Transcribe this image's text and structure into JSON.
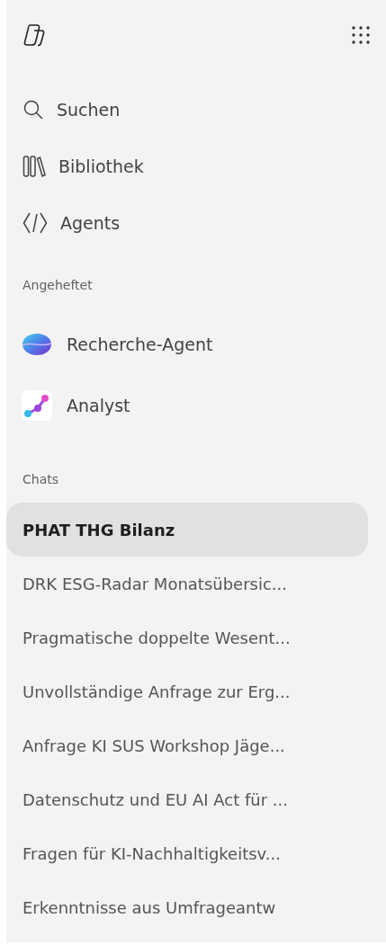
{
  "nav": [
    {
      "kind": "search",
      "label": "Suchen"
    },
    {
      "kind": "library",
      "label": "Bibliothek"
    },
    {
      "kind": "agents",
      "label": "Agents"
    }
  ],
  "pinned": {
    "heading": "Angeheftet",
    "items": [
      {
        "kind": "researcher",
        "label": "Recherche-Agent"
      },
      {
        "kind": "analyst",
        "label": "Analyst"
      }
    ]
  },
  "chats": {
    "heading": "Chats",
    "items": [
      {
        "label": "PHAT THG Bilanz",
        "selected": true
      },
      {
        "label": "DRK ESG-Radar Monatsübersic...",
        "selected": false
      },
      {
        "label": "Pragmatische doppelte Wesent...",
        "selected": false
      },
      {
        "label": "Unvollständige Anfrage zur Erg...",
        "selected": false
      },
      {
        "label": "Anfrage KI SUS Workshop Jäge...",
        "selected": false
      },
      {
        "label": "Datenschutz und EU AI Act für ...",
        "selected": false
      },
      {
        "label": "Fragen für KI-Nachhaltigkeitsv...",
        "selected": false
      },
      {
        "label": "Erkenntnisse aus Umfrageantw",
        "selected": false
      }
    ]
  }
}
